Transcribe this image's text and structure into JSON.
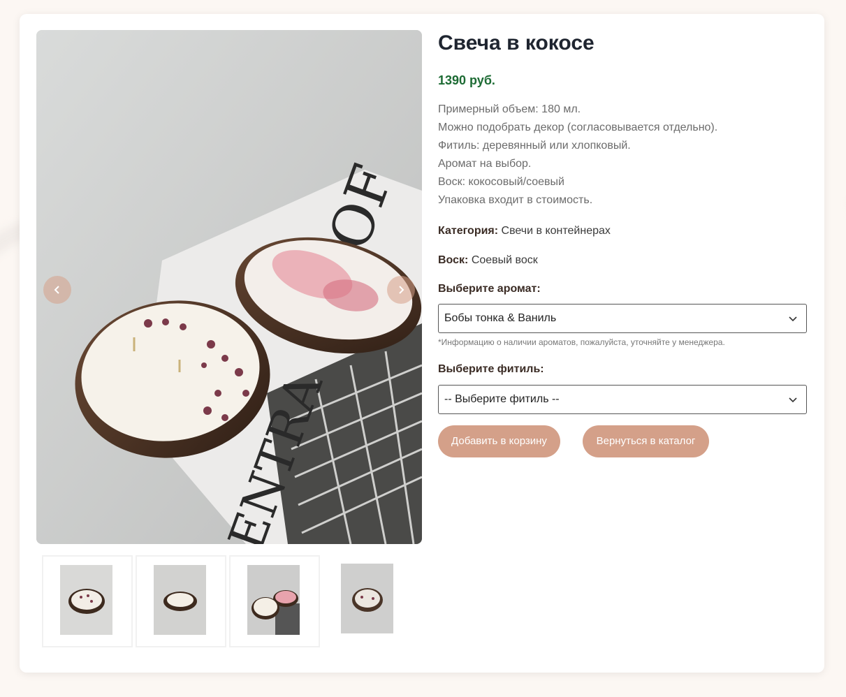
{
  "product": {
    "title": "Свеча в кокосе",
    "price": "1390 руб.",
    "description": [
      "Примерный объем: 180 мл.",
      "Можно подобрать декор (согласовывается отдельно).",
      "Фитиль: деревянный или хлопковый.",
      "Аромат на выбор.",
      "Воск: кокосовый/соевый",
      "Упаковка входит в стоимость."
    ],
    "category_label": "Категория:",
    "category_value": "Свечи в контейнерах",
    "wax_label": "Воск:",
    "wax_value": "Соевый воск"
  },
  "options": {
    "aroma_label": "Выберите аромат:",
    "aroma_selected": "Бобы тонка & Ваниль",
    "aroma_note": "*Информацию о наличии ароматов, пожалуйста, уточняйте у менеджера.",
    "wick_label": "Выберите фитиль:",
    "wick_selected": "-- Выберите фитиль --"
  },
  "buttons": {
    "add_to_cart": "Добавить в корзину",
    "back_to_catalog": "Вернуться в каталог"
  },
  "gallery": {
    "prev_icon": "chevron-left-icon",
    "next_icon": "chevron-right-icon",
    "thumbnail_count": 4
  },
  "colors": {
    "accent": "#d4a089",
    "price": "#1d6b34",
    "title": "#1f2530"
  }
}
